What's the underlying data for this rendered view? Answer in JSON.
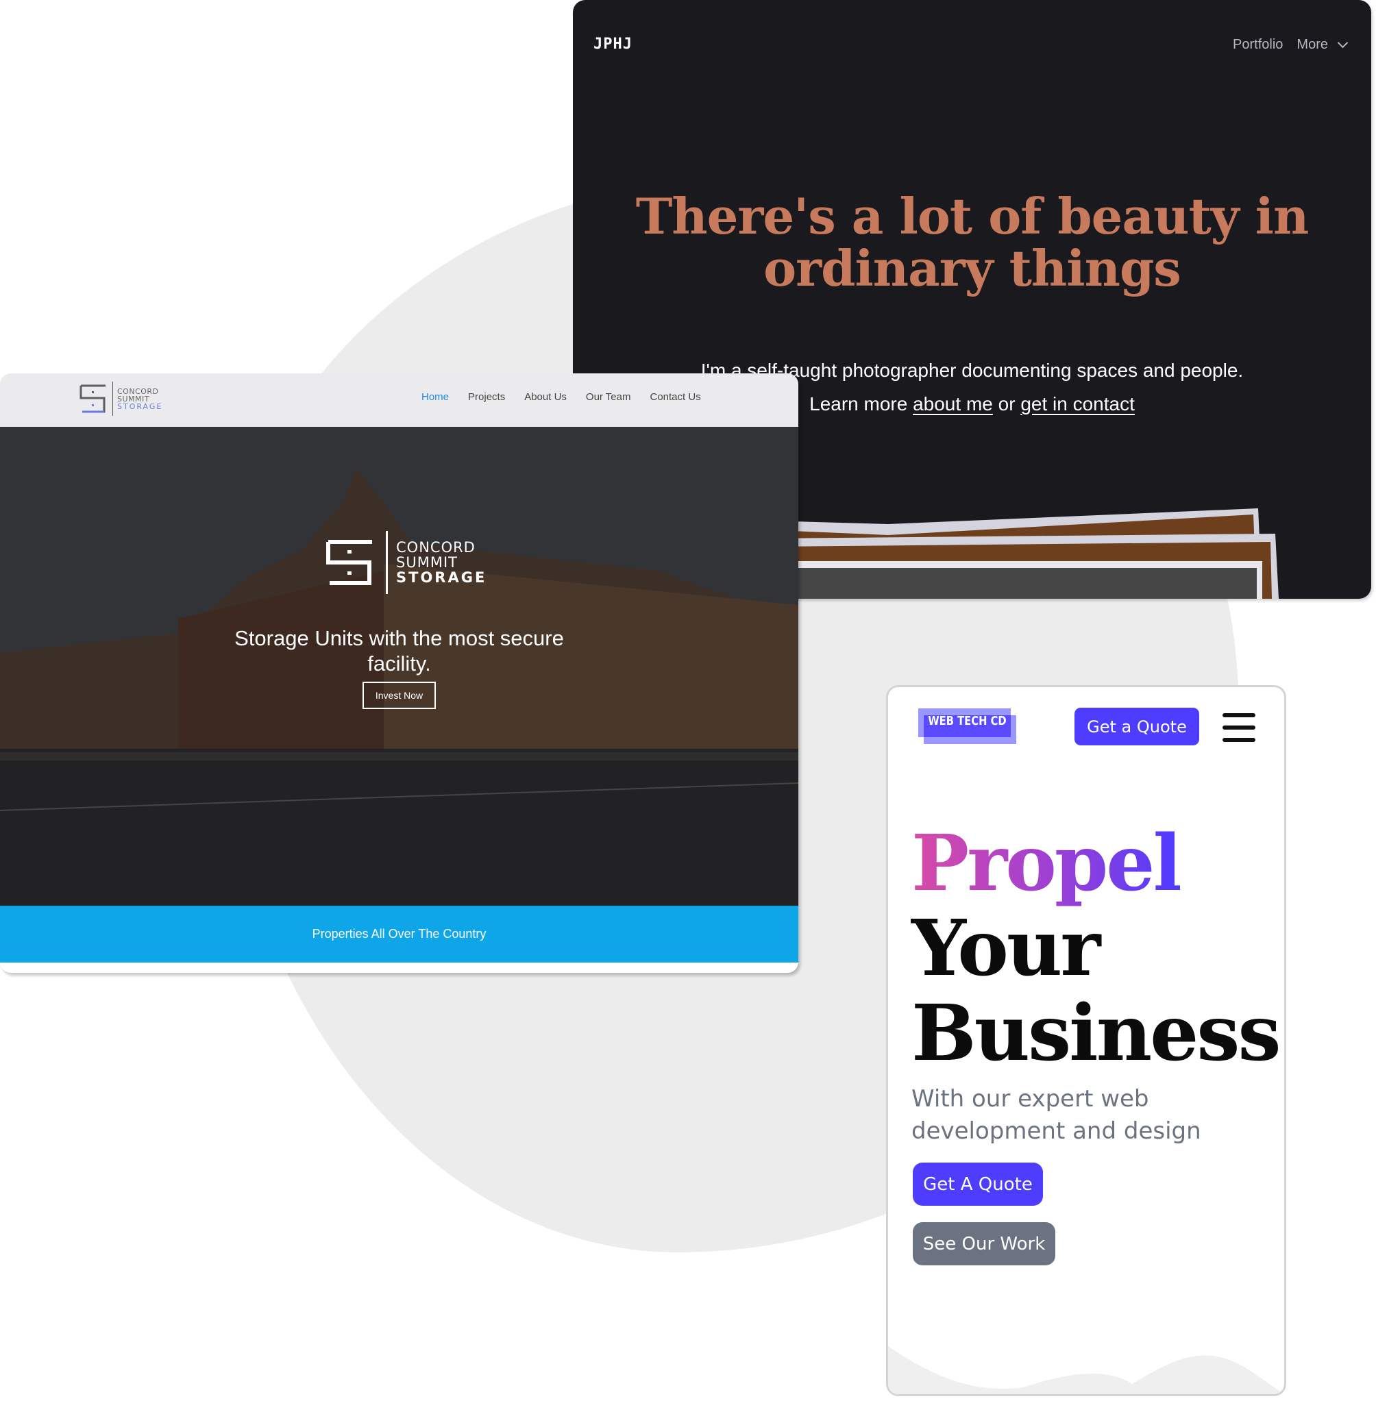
{
  "colors": {
    "background_blob": "#ececec",
    "dark_card_bg": "#1a191e",
    "dark_headline": "#c77a5c",
    "storage_nav_active": "#1e88e5",
    "storage_band": "#0fa5e9",
    "webtech_primary": "#4f3dff",
    "webtech_secondary_btn": "#6b7382",
    "webtech_subtext": "#6b7280"
  },
  "portfolio_site": {
    "logo": "JPHJ",
    "nav": [
      {
        "label": "Portfolio"
      },
      {
        "label": "More",
        "icon": "chevron-down-icon"
      }
    ],
    "headline_line1": "There's a lot of beauty in",
    "headline_line2": "ordinary things",
    "subtitle": "I'm a self-taught photographer documenting spaces and people.",
    "learn_prefix": "Learn more ",
    "about_link": "about me",
    "or_text": " or ",
    "contact_link": "get in contact"
  },
  "storage_site": {
    "logo": {
      "line1": "CONCORD",
      "line2": "SUMMIT",
      "line3": "STORAGE"
    },
    "nav": [
      {
        "label": "Home",
        "active": true
      },
      {
        "label": "Projects",
        "active": false
      },
      {
        "label": "About Us",
        "active": false
      },
      {
        "label": "Our Team",
        "active": false
      },
      {
        "label": "Contact Us",
        "active": false
      }
    ],
    "hero_logo": {
      "line1": "CONCORD",
      "line2": "SUMMIT",
      "line3": "STORAGE"
    },
    "hero_text_line1": "Storage Units with the most secure",
    "hero_text_line2": "facility.",
    "cta_label": "Invest Now",
    "band_text": "Properties All Over The Country"
  },
  "webtech_site": {
    "logo": "WEB TECH CD",
    "nav_cta": "Get a Quote",
    "menu_icon": "hamburger-icon",
    "headline": {
      "word1": "Propel",
      "word2": "Your",
      "word3": "Business"
    },
    "subtitle_line1": "With our expert web",
    "subtitle_line2": "development and design",
    "primary_button": "Get A Quote",
    "secondary_button": "See Our Work"
  }
}
